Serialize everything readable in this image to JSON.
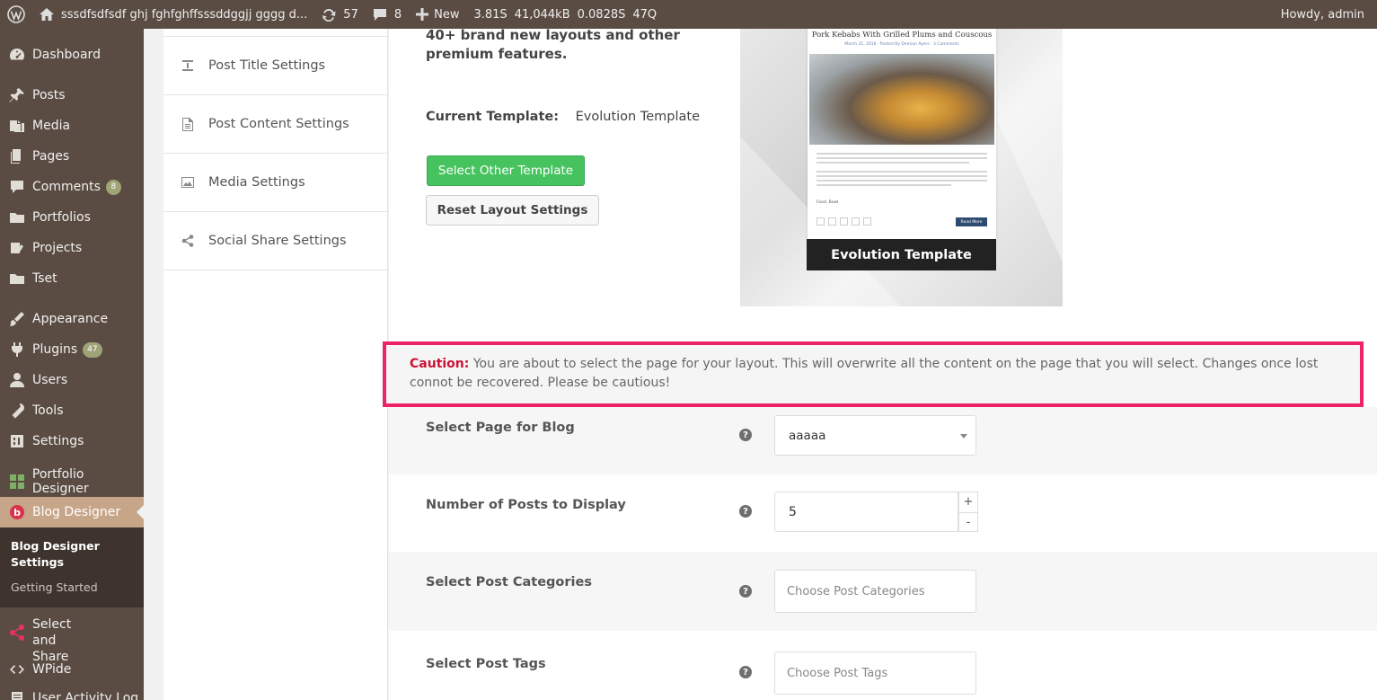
{
  "adminbar": {
    "site_title": "sssdfsdfsdf ghj fghfghffsssddggjj gggg d...",
    "updates_count": "57",
    "comments_count": "8",
    "new_label": "New",
    "perf_time": "3.81S",
    "perf_mem": "41,044kB",
    "perf_query_time": "0.0828S",
    "perf_queries": "47Q",
    "howdy": "Howdy, admin"
  },
  "sidebar": {
    "items": [
      {
        "label": "Dashboard",
        "icon": "dashboard-icon"
      },
      {
        "label": "Posts",
        "icon": "pin-icon"
      },
      {
        "label": "Media",
        "icon": "media-icon"
      },
      {
        "label": "Pages",
        "icon": "pages-icon"
      },
      {
        "label": "Comments",
        "icon": "comment-icon",
        "badge": "8"
      },
      {
        "label": "Portfolios",
        "icon": "folder-icon"
      },
      {
        "label": "Projects",
        "icon": "projects-icon"
      },
      {
        "label": "Tset",
        "icon": "folder-icon"
      },
      {
        "label": "Appearance",
        "icon": "brush-icon"
      },
      {
        "label": "Plugins",
        "icon": "plugin-icon",
        "badge": "47"
      },
      {
        "label": "Users",
        "icon": "user-icon"
      },
      {
        "label": "Tools",
        "icon": "wrench-icon"
      },
      {
        "label": "Settings",
        "icon": "settings-icon"
      },
      {
        "label": "Portfolio Designer",
        "icon": "grid-icon"
      },
      {
        "label": "Blog Designer",
        "icon": "blog-icon"
      },
      {
        "label": "Select and Share",
        "icon": "share-icon"
      },
      {
        "label": "WPide",
        "icon": "code-icon"
      },
      {
        "label": "User Activity Log",
        "icon": "log-icon"
      }
    ],
    "submenu": {
      "active": "Blog Designer Settings",
      "getting_started": "Getting Started"
    }
  },
  "nav": {
    "items": [
      {
        "label": "Post Title Settings",
        "icon": "title-icon"
      },
      {
        "label": "Post Content Settings",
        "icon": "document-icon"
      },
      {
        "label": "Media Settings",
        "icon": "image-icon"
      },
      {
        "label": "Social Share Settings",
        "icon": "share-icon"
      }
    ]
  },
  "main": {
    "intro": "40+ brand new layouts and other premium features.",
    "current_template_label": "Current Template:",
    "current_template_value": "Evolution Template",
    "select_other_button": "Select Other Template",
    "reset_button": "Reset Layout Settings",
    "preview": {
      "post_title": "Pork Kebabs With Grilled Plums and Couscous",
      "post_meta": "March 31, 2016 · Posted By Demian Ayers · 3 Comments",
      "category_link": "Food, Bowl",
      "read_more": "Read More",
      "template_name": "Evolution Template"
    },
    "caution_label": "Caution:",
    "caution_text": " You are about to select the page for your layout. This will overwrite all the content on the page that you will select. Changes once lost connot be recovered. Please be cautious!"
  },
  "fields": {
    "page_label": "Select Page for Blog",
    "page_value": "aaaaa",
    "posts_label": "Number of Posts to Display",
    "posts_value": "5",
    "categories_label": "Select Post Categories",
    "categories_placeholder": "Choose Post Categories",
    "tags_label": "Select Post Tags",
    "tags_placeholder": "Choose Post Tags",
    "help_glyph": "?",
    "plus": "+",
    "minus": "-"
  }
}
